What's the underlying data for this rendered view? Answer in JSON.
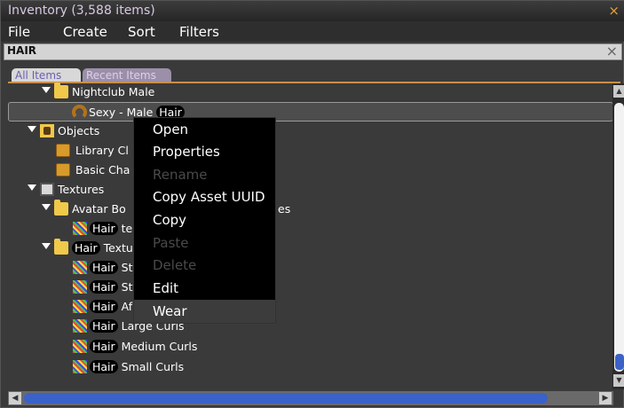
{
  "window": {
    "title": "Inventory (3,588 items)",
    "close": "×"
  },
  "menu": [
    "File",
    "Create",
    "Sort",
    "Filters"
  ],
  "search": {
    "value": "HAIR",
    "clear": "×"
  },
  "tabs": {
    "all": "All Items",
    "recent": "Recent Items"
  },
  "tree": [
    {
      "label": "Nightclub Male"
    },
    {
      "pre": "Sexy - Male ",
      "hl": "Hair"
    },
    {
      "label": "Objects"
    },
    {
      "label": "Library Cl"
    },
    {
      "label": "Basic Cha"
    },
    {
      "label": "Textures"
    },
    {
      "label": "Avatar Bo",
      "tail": "es"
    },
    {
      "hl": "Hair",
      "post": " te"
    },
    {
      "hl": "Hair",
      "post": " Textu"
    },
    {
      "hl": "Hair",
      "post": " St"
    },
    {
      "hl": "Hair",
      "post": " St"
    },
    {
      "hl": "Hair",
      "post": " Af"
    },
    {
      "hl": "Hair",
      "post": " Large Curls"
    },
    {
      "hl": "Hair",
      "post": " Medium Curls"
    },
    {
      "hl": "Hair",
      "post": " Small Curls"
    }
  ],
  "context_menu": [
    {
      "label": "Open",
      "enabled": true
    },
    {
      "label": "Properties",
      "enabled": true
    },
    {
      "label": "Rename",
      "enabled": false
    },
    {
      "label": "Copy Asset UUID",
      "enabled": true
    },
    {
      "label": "Copy",
      "enabled": true
    },
    {
      "label": "Paste",
      "enabled": false
    },
    {
      "label": "Delete",
      "enabled": false
    },
    {
      "label": "Edit",
      "enabled": true
    },
    {
      "label": "Wear",
      "enabled": true,
      "hover": true
    }
  ]
}
